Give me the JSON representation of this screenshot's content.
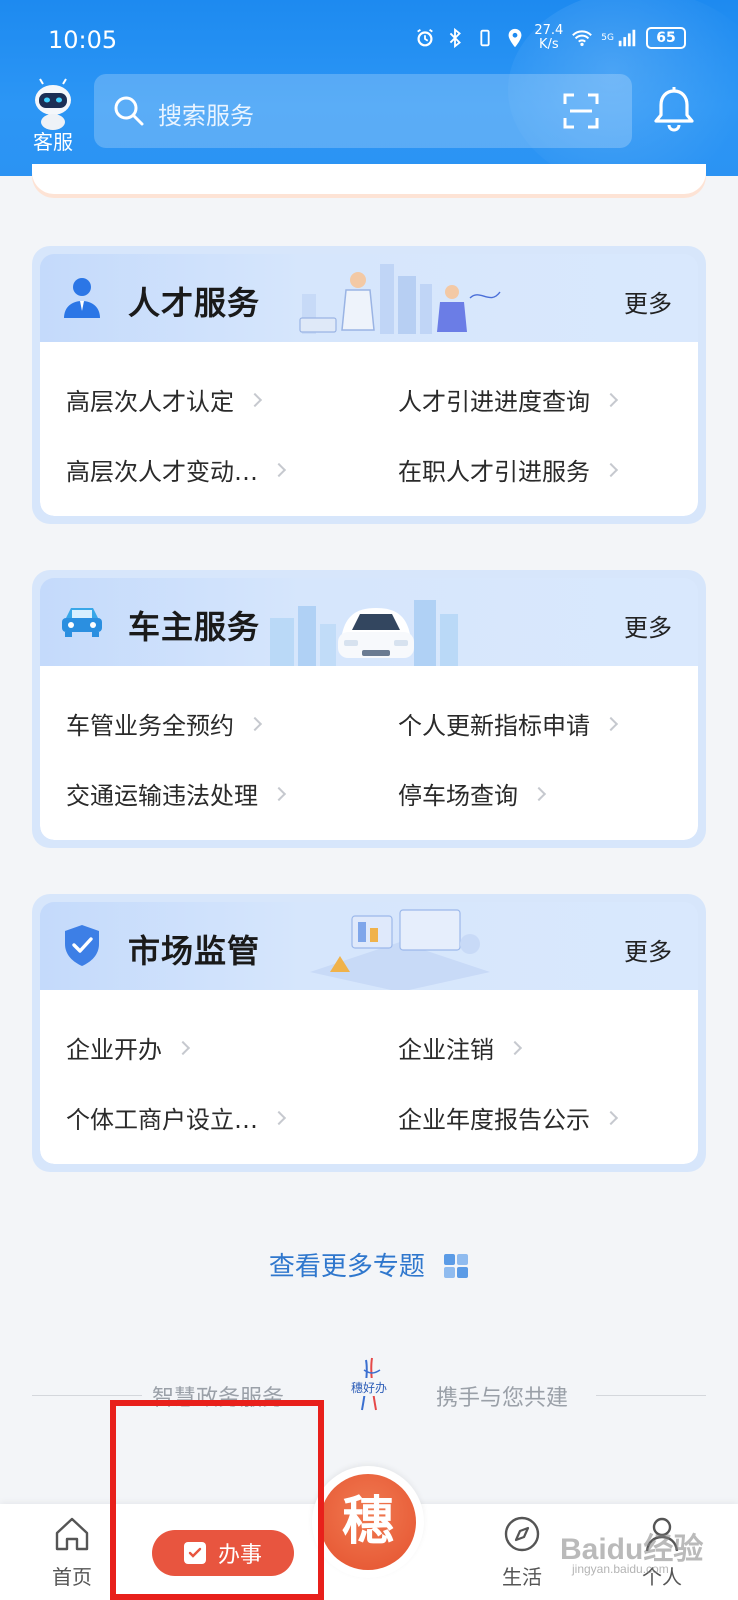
{
  "status_bar": {
    "time": "10:05",
    "net_speed_value": "27.4",
    "net_speed_unit": "K/s",
    "network_type": "5G",
    "battery": "65"
  },
  "header": {
    "service_label": "客服",
    "search_placeholder": "搜索服务"
  },
  "sections": [
    {
      "title": "人才服务",
      "more": "更多",
      "items": [
        "高层次人才认定",
        "人才引进进度查询",
        "高层次人才变动…",
        "在职人才引进服务"
      ]
    },
    {
      "title": "车主服务",
      "more": "更多",
      "items": [
        "车管业务全预约",
        "个人更新指标申请",
        "交通运输违法处理",
        "停车场查询"
      ]
    },
    {
      "title": "市场监管",
      "more": "更多",
      "items": [
        "企业开办",
        "企业注销",
        "个体工商户设立…",
        "企业年度报告公示"
      ]
    }
  ],
  "more_topics": "查看更多专题",
  "slogan": {
    "left": "智慧政务服务",
    "right": "携手与您共建",
    "logo_text": "穗好办"
  },
  "bottom_nav": {
    "home": "首页",
    "task": "办事",
    "emblem": "穗",
    "life": "生活",
    "me": "个人"
  },
  "watermark": {
    "main": "Baidu经验",
    "sub": "jingyan.baidu.com"
  },
  "colors": {
    "header_blue": "#1d8af0",
    "accent_link": "#2f77cd",
    "task_orange": "#e8553f",
    "highlight_frame": "#e8201b"
  }
}
